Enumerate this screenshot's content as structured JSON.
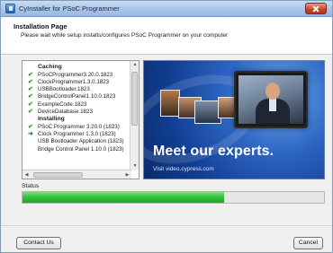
{
  "window": {
    "title": "CyInstaller for PSoC Programmer"
  },
  "header": {
    "title": "Installation Page",
    "subtitle": "Please wait while setup installs/configures PSoC Programmer on your computer"
  },
  "install_list": {
    "groups": [
      {
        "title": "Caching",
        "items": [
          {
            "label": "PSoCProgrammer3.20.0.1823",
            "state": "done"
          },
          {
            "label": "ClockProgrammer1.3.0.1823",
            "state": "done"
          },
          {
            "label": "USBBootloader.1823",
            "state": "done"
          },
          {
            "label": "BridgeControlPanel1.10.0.1823",
            "state": "done"
          },
          {
            "label": "ExampleCode.1823",
            "state": "done"
          },
          {
            "label": "DeviceDatabase.1823",
            "state": "done"
          }
        ]
      },
      {
        "title": "Installing",
        "items": [
          {
            "label": "PSoC Programmer 3.20.0 (1823)",
            "state": "done"
          },
          {
            "label": "Clock Programmer 1.3.0 (1823)",
            "state": "current"
          },
          {
            "label": "USB Bootloader Application (1823)",
            "state": "pending"
          },
          {
            "label": "Bridge Control Panel 1.10.0 (1823)",
            "state": "pending"
          }
        ]
      }
    ],
    "icons": {
      "done": "check-icon",
      "current": "arrow-right-icon"
    }
  },
  "banner": {
    "headline": "Meet our experts.",
    "visit_text": "Visit video.cypress.com"
  },
  "status": {
    "label": "Status",
    "progress_percent": 67
  },
  "buttons": {
    "contact": "Contact Us",
    "cancel": "Cancel"
  }
}
